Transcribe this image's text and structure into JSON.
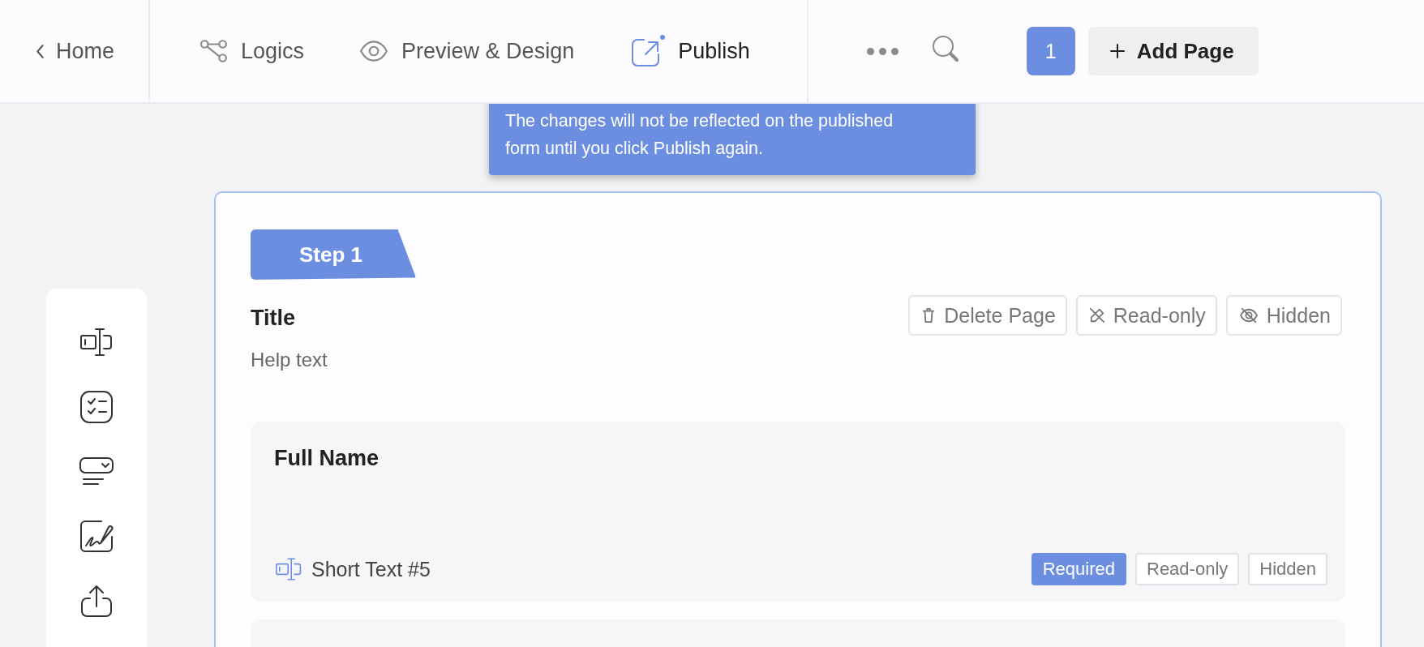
{
  "top_bar": {
    "back": {
      "label": "Home"
    },
    "nav": [
      {
        "label": "Logics",
        "selected": false
      },
      {
        "label": "Preview & Design",
        "selected": false
      },
      {
        "label": "Publish",
        "selected": true
      }
    ],
    "page_number": "1",
    "add_page": "Add Page"
  },
  "tooltip": "The changes will not be reflected on the published form until you click Publish again.",
  "sidebar": {
    "items": [
      {
        "kind": "short_text"
      },
      {
        "kind": "checklist"
      },
      {
        "kind": "dropdown"
      },
      {
        "kind": "signature"
      },
      {
        "kind": "upload"
      }
    ]
  },
  "page": {
    "step": "Step 1",
    "title": "Title",
    "help_text": "Help text",
    "actions": [
      {
        "label": "Delete Page"
      },
      {
        "label": "Read-only"
      },
      {
        "label": "Hidden"
      }
    ]
  },
  "fields": [
    {
      "label": "Full Name",
      "type_label": "Short Text #5",
      "tags": [
        {
          "label": "Required",
          "selected": true
        },
        {
          "label": "Read-only",
          "selected": false
        },
        {
          "label": "Hidden",
          "selected": false
        }
      ]
    }
  ]
}
